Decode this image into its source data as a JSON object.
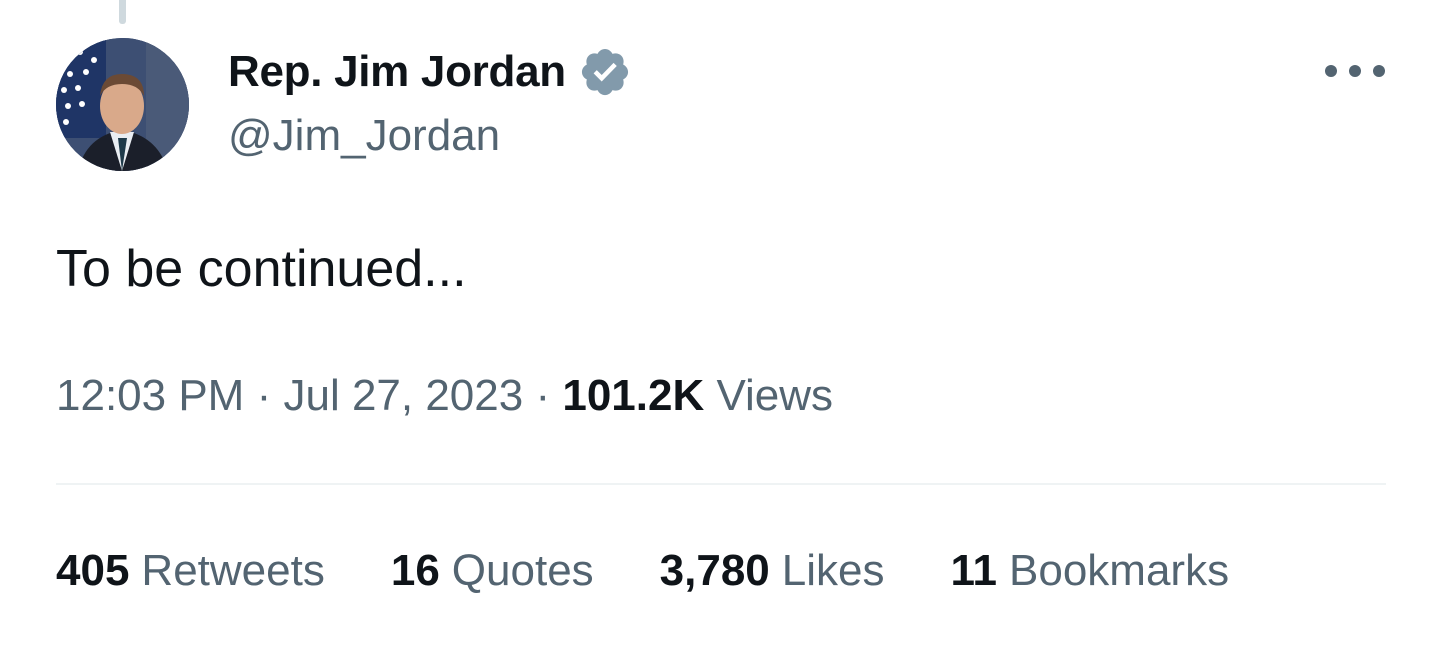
{
  "tweet": {
    "author": {
      "display_name": "Rep. Jim Jordan",
      "handle": "@Jim_Jordan",
      "verified_icon": "verified-badge-icon",
      "verified_color": "#829aab"
    },
    "more_icon": "more-options-icon",
    "text": "To be continued...",
    "time": "12:03 PM",
    "separator": "·",
    "date": "Jul 27, 2023",
    "views_count": "101.2K",
    "views_label": "Views"
  },
  "stats": [
    {
      "count": "405",
      "label": "Retweets"
    },
    {
      "count": "16",
      "label": "Quotes"
    },
    {
      "count": "3,780",
      "label": "Likes"
    },
    {
      "count": "11",
      "label": "Bookmarks"
    }
  ],
  "colors": {
    "primary_text": "#0f1419",
    "secondary_text": "#536471",
    "divider": "#eff3f4"
  }
}
